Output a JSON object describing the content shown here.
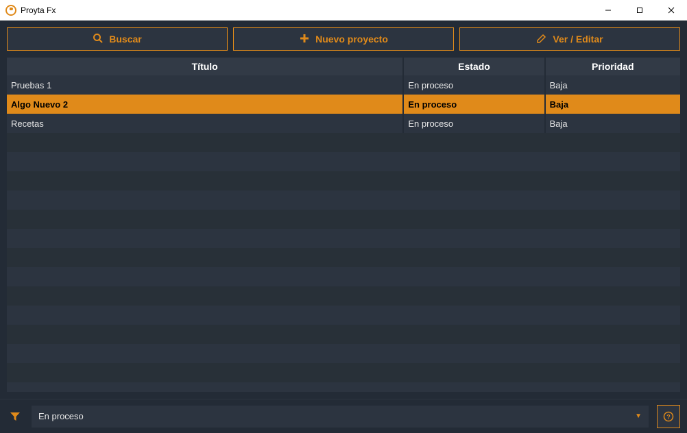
{
  "window": {
    "title": "Proyta Fx"
  },
  "toolbar": {
    "search_label": "Buscar",
    "new_project_label": "Nuevo proyecto",
    "view_edit_label": "Ver / Editar"
  },
  "table": {
    "headers": {
      "titulo": "Título",
      "estado": "Estado",
      "prioridad": "Prioridad"
    },
    "rows": [
      {
        "titulo": "Pruebas 1",
        "estado": "En proceso",
        "prioridad": "Baja",
        "selected": false
      },
      {
        "titulo": "Algo Nuevo 2",
        "estado": "En proceso",
        "prioridad": "Baja",
        "selected": true
      },
      {
        "titulo": "Recetas",
        "estado": "En proceso",
        "prioridad": "Baja",
        "selected": false
      }
    ]
  },
  "statusbar": {
    "filter_value": "En proceso"
  },
  "colors": {
    "accent": "#e08a1a",
    "bg": "#232b36"
  }
}
